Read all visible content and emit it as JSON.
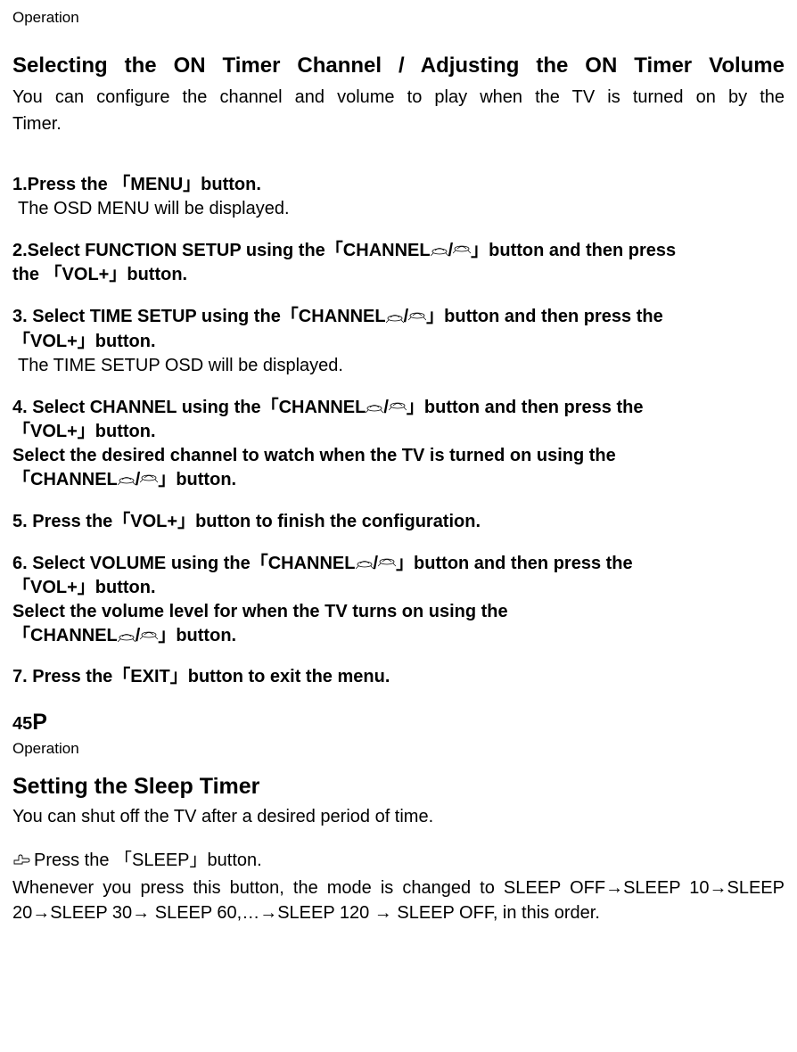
{
  "header1": "Operation",
  "title1": "Selecting the ON Timer Channel / Adjusting the ON Timer Volume",
  "intro1_line1": "You can configure the channel and volume to play when the TV is turned on by the",
  "intro1_line2": "Timer.",
  "step1_bold": "1.Press the 「MENU」button.",
  "step1_note": "The OSD MENU will be displayed.",
  "step2_a": "2.Select FUNCTION SETUP using the「CHANNEL",
  "step2_b": "/",
  "step2_c": "」button and then press",
  "step2_d": "the 「VOL+」button.",
  "step3_a": "3. Select TIME SETUP using the「CHANNEL",
  "step3_b": "/",
  "step3_c": "」button and then press the",
  "step3_d": "「VOL+」button.",
  "step3_note_pre": "The",
  "step3_note": " TIME SETUP OSD will be displayed.",
  "step4_a": "4. Select CHANNEL using the「CHANNEL",
  "step4_b": "/",
  "step4_c": "」button and then press the",
  "step4_d": "「VOL+」button.",
  "step4_e": " Select the desired channel to watch when the TV is turned on using the",
  "step4_f": "「CHANNEL",
  "step4_g": "/",
  "step4_h": "」button.",
  "step5": "5. Press the「VOL+」button to finish the configuration.",
  "step6_a": "6. Select VOLUME using the「CHANNEL",
  "step6_b": "/",
  "step6_c": "」button and then press the",
  "step6_d": "「VOL+」button.",
  "step6_e": "  Select the volume level for when the TV turns on using the",
  "step6_f": "「CHANNEL",
  "step6_g": "/",
  "step6_h": "」button.",
  "step7": "7. Press the「EXIT」button to exit the menu.",
  "page_num_pre": "45",
  "page_num_big": "P",
  "header2": "Operation",
  "title2": "Setting the Sleep Timer",
  "intro2": "You can shut off the TV after a desired period of time.",
  "sleep_step": "Press the 「SLEEP」button.",
  "sleep_detail_l1": " Whenever you press this button, the mode is changed to SLEEP OFF→SLEEP 10→SLEEP",
  "sleep_detail_l2": "20→SLEEP 30→ SLEEP 60,…→SLEEP 120 → SLEEP OFF, in this order."
}
